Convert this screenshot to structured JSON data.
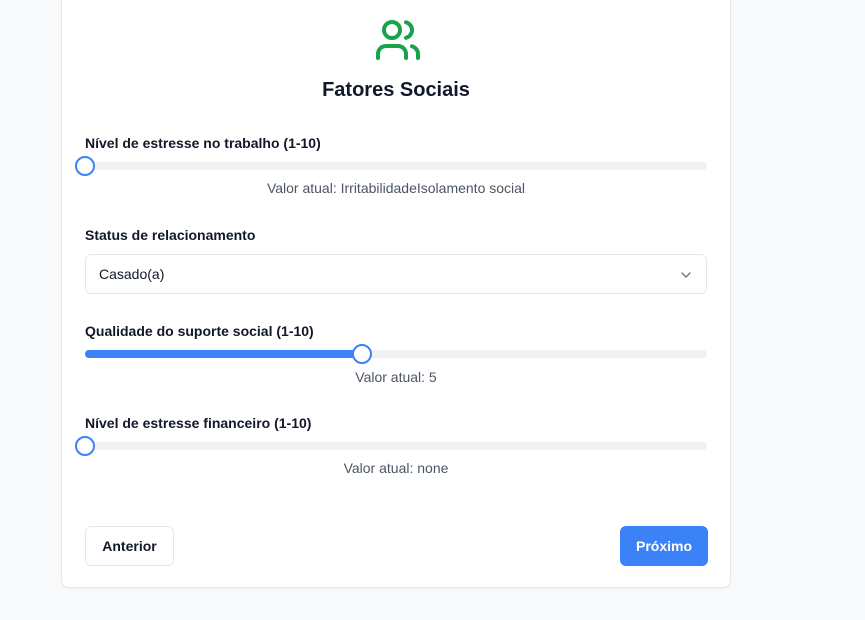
{
  "section": {
    "title": "Fatores Sociais",
    "icon": "users-icon",
    "accent_color": "#16a34a"
  },
  "fields": {
    "work_stress": {
      "label": "Nível de estresse no trabalho (1-10)",
      "value_text": "Valor atual: IrritabilidadeIsolamento social",
      "level_fraction": 0.0
    },
    "relationship": {
      "label": "Status de relacionamento",
      "selected": "Casado(a)"
    },
    "social_support": {
      "label": "Qualidade do suporte social (1-10)",
      "value_text": "Valor atual: 5",
      "level_fraction": 0.446
    },
    "financial_stress": {
      "label": "Nível de estresse financeiro (1-10)",
      "value_text": "Valor atual: none",
      "level_fraction": 0.0
    }
  },
  "buttons": {
    "previous": "Anterior",
    "next": "Próximo"
  },
  "colors": {
    "primary": "#3b82f6",
    "track": "#f1f1f3"
  }
}
